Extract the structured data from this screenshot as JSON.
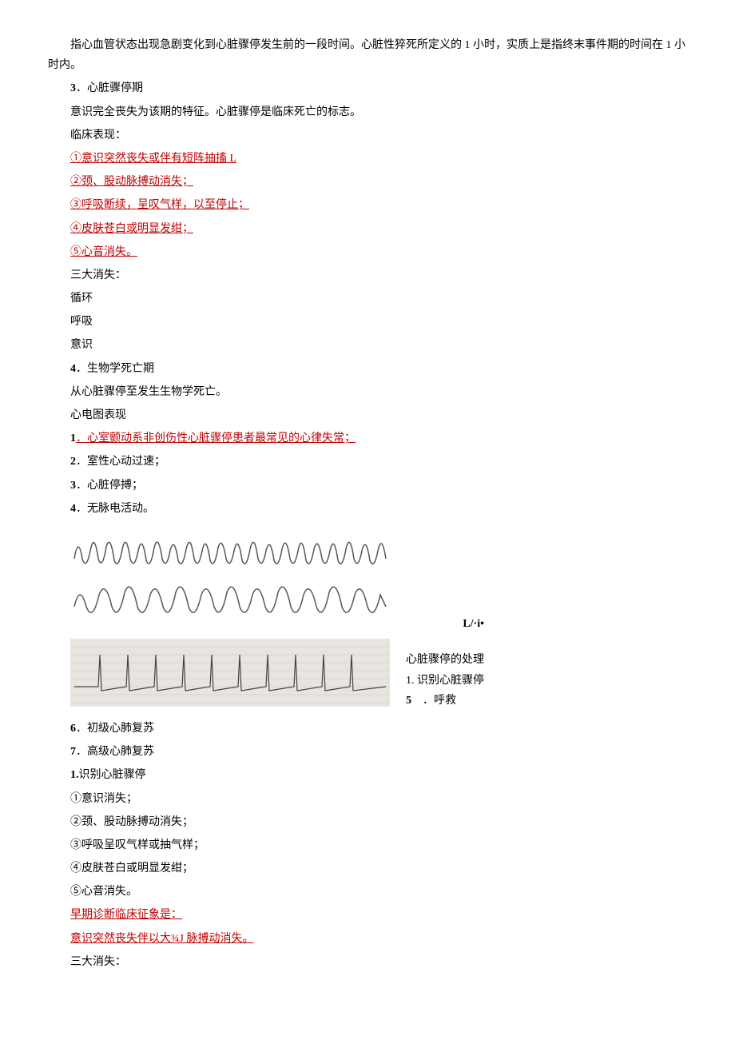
{
  "p1": "指心血管状态出现急剧变化到心脏骤停发生前的一段时间。心脏性猝死所定义的 1 小时，实质上是指终末事件期的时间在 1 小时内。",
  "h3num": "3",
  "h3text": "．心脏骤停期",
  "p2": "意识完全丧失为该期的特征。心脏骤停是临床死亡的标志。",
  "p3": "临床表现：",
  "r1": "①意识突然丧失或伴有短阵抽搐 L",
  "r2": "②颈、股动脉搏动消失；",
  "r3": "③呼吸断续，呈叹气样，以至停止；",
  "r4": "④皮肤苍白或明显发绀；",
  "r5": "⑤心音消失。",
  "p4": "三大消失：",
  "p5": "循环",
  "p6": "呼吸",
  "p7": "意识",
  "h4num": "4",
  "h4text": "．生物学死亡期",
  "p8": "从心脏骤停至发生生物学死亡。",
  "p9": "心电图表现",
  "l1num": "1",
  "l1text": "．心室颤动系非创伤性心脏骤停患者最常见的心律失常；",
  "l2num": "2",
  "l2text": "．室性心动过速；",
  "l3num": "3",
  "l3text": "．心脏停搏；",
  "l4num": "4",
  "l4text": "．无脉电活动。",
  "side_marker": "L/·i•",
  "side1": "心脏骤停的处理",
  "side2": "1. 识别心脏骤停",
  "side3num": "5",
  "side3text": "．呼救",
  "l6num": "6",
  "l6text": "．初级心肺复苏",
  "l7num": "7",
  "l7text": "．高级心肺复苏",
  "p10": "1.识别心脏骤停",
  "p11": "①意识消失；",
  "p12": "②颈、股动脉搏动消失；",
  "p13": "③呼吸呈叹气样或抽气样；",
  "p14": "④皮肤苍白或明显发绀；",
  "p15": "⑤心音消失。",
  "r6": "早期诊断临床征象是：",
  "r7": "意识突然丧失伴以大¾J 脉搏动消失。",
  "p16": "三大消失："
}
